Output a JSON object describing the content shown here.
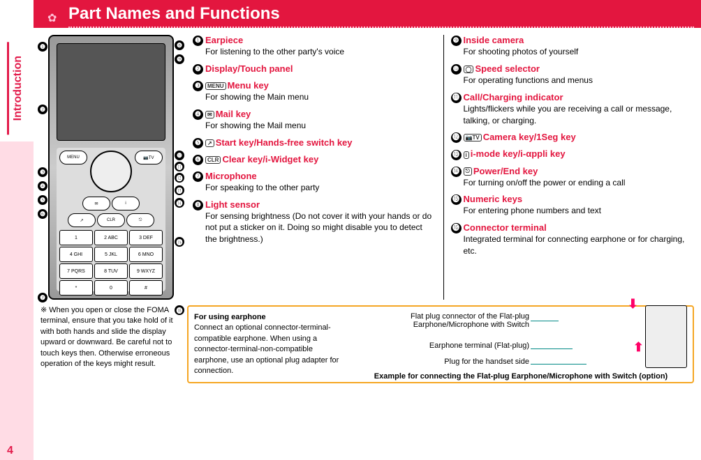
{
  "header": {
    "title": "Part Names and Functions",
    "flower": "✿"
  },
  "tab": {
    "label": "Introduction"
  },
  "page_number": "4",
  "markers": [
    "❶",
    "❷",
    "❸",
    "❹",
    "❺",
    "❻",
    "❼",
    "❽",
    "❾",
    "❿",
    "⓫",
    "⓬",
    "⓭",
    "⓮",
    "⓯",
    "⓰"
  ],
  "col1": [
    {
      "n": "❶",
      "title": "Earpiece",
      "icon": "",
      "desc": "For listening to the other party's voice"
    },
    {
      "n": "❷",
      "title": "Display/Touch panel",
      "icon": "",
      "desc": ""
    },
    {
      "n": "❸",
      "title": "Menu key",
      "icon": "MENU",
      "desc": "For showing the Main menu"
    },
    {
      "n": "❹",
      "title": "Mail key",
      "icon": "✉",
      "desc": "For showing the Mail menu"
    },
    {
      "n": "❺",
      "title": "Start key/Hands-free switch key",
      "icon": "↗",
      "desc": ""
    },
    {
      "n": "❻",
      "title": "Clear key/i-Widget key",
      "icon": "CLR",
      "desc": ""
    },
    {
      "n": "❼",
      "title": "Microphone",
      "icon": "",
      "desc": "For speaking to the other party"
    },
    {
      "n": "❽",
      "title": "Light sensor",
      "icon": "",
      "desc": "For sensing brightness (Do not cover it with your hands or do not put a sticker on it. Doing so might disable you to detect the brightness.)"
    }
  ],
  "col2": [
    {
      "n": "❾",
      "title": "Inside camera",
      "icon": "",
      "desc": "For shooting photos of yourself"
    },
    {
      "n": "❿",
      "title": "Speed selector",
      "icon": "◯",
      "desc": "For operating functions and menus"
    },
    {
      "n": "⓫",
      "title": "Call/Charging indicator",
      "icon": "",
      "desc": "Lights/flickers while you are receiving a call or message, talking, or charging."
    },
    {
      "n": "⓬",
      "title": "Camera key/1Seg key",
      "icon": "📷TV",
      "desc": ""
    },
    {
      "n": "⓭",
      "title": "i-mode key/i-αppli key",
      "icon": "i",
      "desc": ""
    },
    {
      "n": "⓮",
      "title": "Power/End key",
      "icon": "⎋",
      "desc": "For turning on/off the power or ending a call"
    },
    {
      "n": "⓯",
      "title": "Numeric keys",
      "icon": "",
      "desc": "For entering phone numbers and text"
    },
    {
      "n": "⓰",
      "title": "Connector terminal",
      "icon": "",
      "desc": "Integrated terminal for connecting earphone or for charging, etc."
    }
  ],
  "note": {
    "symbol": "※",
    "text": "When you open or close the FOMA terminal, ensure that you take hold of it with both hands and slide the display upward or downward. Be careful not to touch keys then. Otherwise erroneous operation of the keys might result."
  },
  "earphone": {
    "title": "For using earphone",
    "text": "Connect an optional connector-terminal-compatible earphone. When using a connector-terminal-non-compatible earphone, use an optional plug adapter for connection.",
    "label1": "Flat plug connector of the Flat-plug Earphone/Microphone with Switch",
    "label2": "Earphone terminal (Flat-plug)",
    "label3": "Plug for the handset side",
    "caption": "Example for connecting the Flat-plug Earphone/Microphone with Switch (option)"
  }
}
